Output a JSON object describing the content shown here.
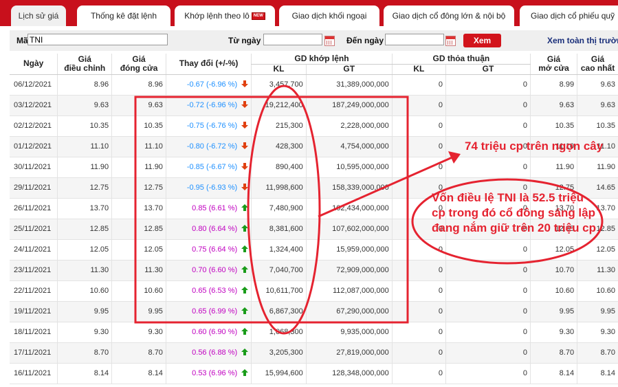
{
  "tabs": [
    {
      "label": "Lịch sử giá"
    },
    {
      "label": "Thống kê đặt lệnh"
    },
    {
      "label": "Khớp lệnh theo lô",
      "badge": "NEW"
    },
    {
      "label": "Giao dịch khối ngoại"
    },
    {
      "label": "Giao dịch cổ đông lớn & nội bộ"
    },
    {
      "label": "Giao dịch cổ phiếu quỹ"
    }
  ],
  "filter": {
    "ma_label": "Mã",
    "ma_value": "TNI",
    "tu_ngay_label": "Từ ngày",
    "tu_ngay_value": "",
    "den_ngay_label": "Đến ngày",
    "den_ngay_value": "",
    "xem_label": "Xem",
    "view_all": "Xem toàn thị trường"
  },
  "headers": {
    "ngay": "Ngày",
    "gia_dieu_chinh": [
      "Giá",
      "điều chỉnh"
    ],
    "gia_dong_cua": [
      "Giá",
      "đóng cửa"
    ],
    "thay_doi": "Thay đổi (+/-%)",
    "gd_khop_lenh": "GD khớp lệnh",
    "gd_thoa_thuan": "GD thỏa thuận",
    "kl": "KL",
    "gt": "GT",
    "gia_mo_cua": [
      "Giá",
      "mở cửa"
    ],
    "gia_cao_nhat": [
      "Giá",
      "cao nhất"
    ]
  },
  "rows": [
    {
      "date": "06/12/2021",
      "adj": "8.96",
      "close": "8.96",
      "change": "-0.67 (-6.96 %)",
      "dir": "down",
      "kl": "3,457,700",
      "gt": "31,389,000,000",
      "tt_kl": "0",
      "tt_gt": "0",
      "open": "8.99",
      "high": "9.63"
    },
    {
      "date": "03/12/2021",
      "adj": "9.63",
      "close": "9.63",
      "change": "-0.72 (-6.96 %)",
      "dir": "down",
      "kl": "19,212,400",
      "gt": "187,249,000,000",
      "tt_kl": "0",
      "tt_gt": "0",
      "open": "9.63",
      "high": "9.63"
    },
    {
      "date": "02/12/2021",
      "adj": "10.35",
      "close": "10.35",
      "change": "-0.75 (-6.76 %)",
      "dir": "down",
      "kl": "215,300",
      "gt": "2,228,000,000",
      "tt_kl": "0",
      "tt_gt": "0",
      "open": "10.35",
      "high": "10.35"
    },
    {
      "date": "01/12/2021",
      "adj": "11.10",
      "close": "11.10",
      "change": "-0.80 (-6.72 %)",
      "dir": "down",
      "kl": "428,300",
      "gt": "4,754,000,000",
      "tt_kl": "0",
      "tt_gt": "0",
      "open": "11.10",
      "high": "11.10"
    },
    {
      "date": "30/11/2021",
      "adj": "11.90",
      "close": "11.90",
      "change": "-0.85 (-6.67 %)",
      "dir": "down",
      "kl": "890,400",
      "gt": "10,595,000,000",
      "tt_kl": "0",
      "tt_gt": "0",
      "open": "11.90",
      "high": "11.90"
    },
    {
      "date": "29/11/2021",
      "adj": "12.75",
      "close": "12.75",
      "change": "-0.95 (-6.93 %)",
      "dir": "down",
      "kl": "11,998,600",
      "gt": "158,339,000,000",
      "tt_kl": "0",
      "tt_gt": "0",
      "open": "12.75",
      "high": "14.65"
    },
    {
      "date": "26/11/2021",
      "adj": "13.70",
      "close": "13.70",
      "change": "0.85 (6.61 %)",
      "dir": "up",
      "kl": "7,480,900",
      "gt": "102,434,000,000",
      "tt_kl": "0",
      "tt_gt": "0",
      "open": "13.70",
      "high": "13.70"
    },
    {
      "date": "25/11/2021",
      "adj": "12.85",
      "close": "12.85",
      "change": "0.80 (6.64 %)",
      "dir": "up",
      "kl": "8,381,600",
      "gt": "107,602,000,000",
      "tt_kl": "0",
      "tt_gt": "0",
      "open": "12.85",
      "high": "12.85"
    },
    {
      "date": "24/11/2021",
      "adj": "12.05",
      "close": "12.05",
      "change": "0.75 (6.64 %)",
      "dir": "up",
      "kl": "1,324,400",
      "gt": "15,959,000,000",
      "tt_kl": "0",
      "tt_gt": "0",
      "open": "12.05",
      "high": "12.05"
    },
    {
      "date": "23/11/2021",
      "adj": "11.30",
      "close": "11.30",
      "change": "0.70 (6.60 %)",
      "dir": "up",
      "kl": "7,040,700",
      "gt": "72,909,000,000",
      "tt_kl": "0",
      "tt_gt": "0",
      "open": "10.70",
      "high": "11.30"
    },
    {
      "date": "22/11/2021",
      "adj": "10.60",
      "close": "10.60",
      "change": "0.65 (6.53 %)",
      "dir": "up",
      "kl": "10,611,700",
      "gt": "112,087,000,000",
      "tt_kl": "0",
      "tt_gt": "0",
      "open": "10.60",
      "high": "10.60"
    },
    {
      "date": "19/11/2021",
      "adj": "9.95",
      "close": "9.95",
      "change": "0.65 (6.99 %)",
      "dir": "up",
      "kl": "6,867,300",
      "gt": "67,290,000,000",
      "tt_kl": "0",
      "tt_gt": "0",
      "open": "9.95",
      "high": "9.95"
    },
    {
      "date": "18/11/2021",
      "adj": "9.30",
      "close": "9.30",
      "change": "0.60 (6.90 %)",
      "dir": "up",
      "kl": "1,068,300",
      "gt": "9,935,000,000",
      "tt_kl": "0",
      "tt_gt": "0",
      "open": "9.30",
      "high": "9.30"
    },
    {
      "date": "17/11/2021",
      "adj": "8.70",
      "close": "8.70",
      "change": "0.56 (6.88 %)",
      "dir": "up",
      "kl": "3,205,300",
      "gt": "27,819,000,000",
      "tt_kl": "0",
      "tt_gt": "0",
      "open": "8.70",
      "high": "8.70"
    },
    {
      "date": "16/11/2021",
      "adj": "8.14",
      "close": "8.14",
      "change": "0.53 (6.96 %)",
      "dir": "up",
      "kl": "15,994,600",
      "gt": "128,348,000,000",
      "tt_kl": "0",
      "tt_gt": "0",
      "open": "8.14",
      "high": "8.14"
    }
  ],
  "annotations": {
    "note_top": "74 triệu cp trên ngọn cây",
    "note_bottom": "Vốn điều lệ TNI là 52.5 triệu cp trong đó cổ đông sáng lập đang nắm giữ trên 20 triệu cp"
  },
  "colors": {
    "brand_red": "#c8101c",
    "annotation_red": "#e52330",
    "negative": "#1e90ff",
    "positive": "#c000c0",
    "up_arrow": "#1a9c1a",
    "down_arrow": "#e04010"
  }
}
